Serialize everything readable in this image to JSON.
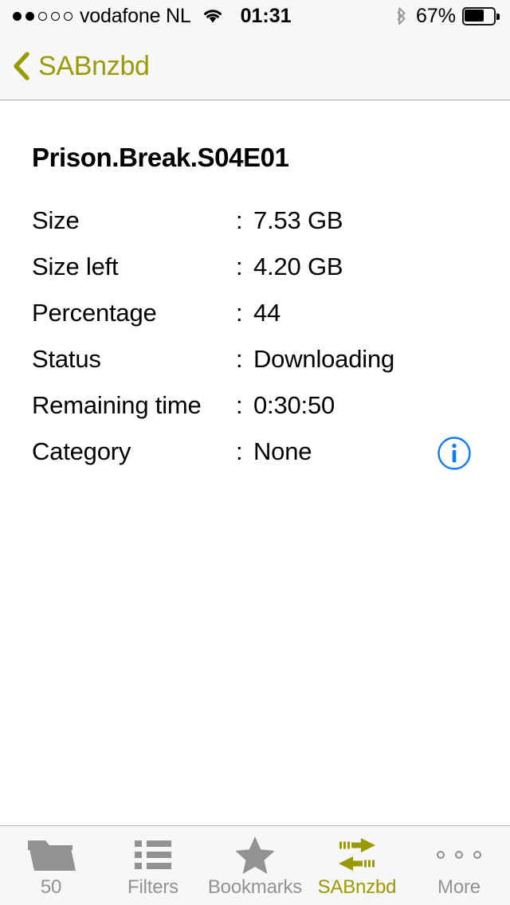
{
  "statusbar": {
    "signal_filled": 2,
    "signal_total": 5,
    "carrier": "vodafone NL",
    "wifi_icon": "wifi-icon",
    "time": "01:31",
    "bluetooth_icon": "bluetooth-icon",
    "battery_percent": "67%",
    "battery_level": 67
  },
  "navbar": {
    "back_icon": "chevron-left-icon",
    "back_label": "SABnzbd"
  },
  "detail": {
    "title": "Prison.Break.S04E01",
    "separator": ":",
    "rows": [
      {
        "label": "Size",
        "value": "7.53 GB"
      },
      {
        "label": "Size left",
        "value": "4.20 GB"
      },
      {
        "label": "Percentage",
        "value": "44"
      },
      {
        "label": "Status",
        "value": "Downloading"
      },
      {
        "label": "Remaining time",
        "value": "0:30:50"
      },
      {
        "label": "Category",
        "value": "None"
      }
    ],
    "info_icon": "info-circle-icon"
  },
  "tabbar": {
    "items": [
      {
        "label": "50",
        "icon": "folder-icon",
        "active": false
      },
      {
        "label": "Filters",
        "icon": "list-icon",
        "active": false
      },
      {
        "label": "Bookmarks",
        "icon": "star-icon",
        "active": false
      },
      {
        "label": "SABnzbd",
        "icon": "transfer-arrows-icon",
        "active": true
      },
      {
        "label": "More",
        "icon": "ellipsis-icon",
        "active": false
      }
    ]
  },
  "colors": {
    "accent": "#9a9a05",
    "info_blue": "#107afc",
    "inactive_gray": "#929292",
    "bar_background": "#f7f7f7",
    "text": "#000000"
  }
}
